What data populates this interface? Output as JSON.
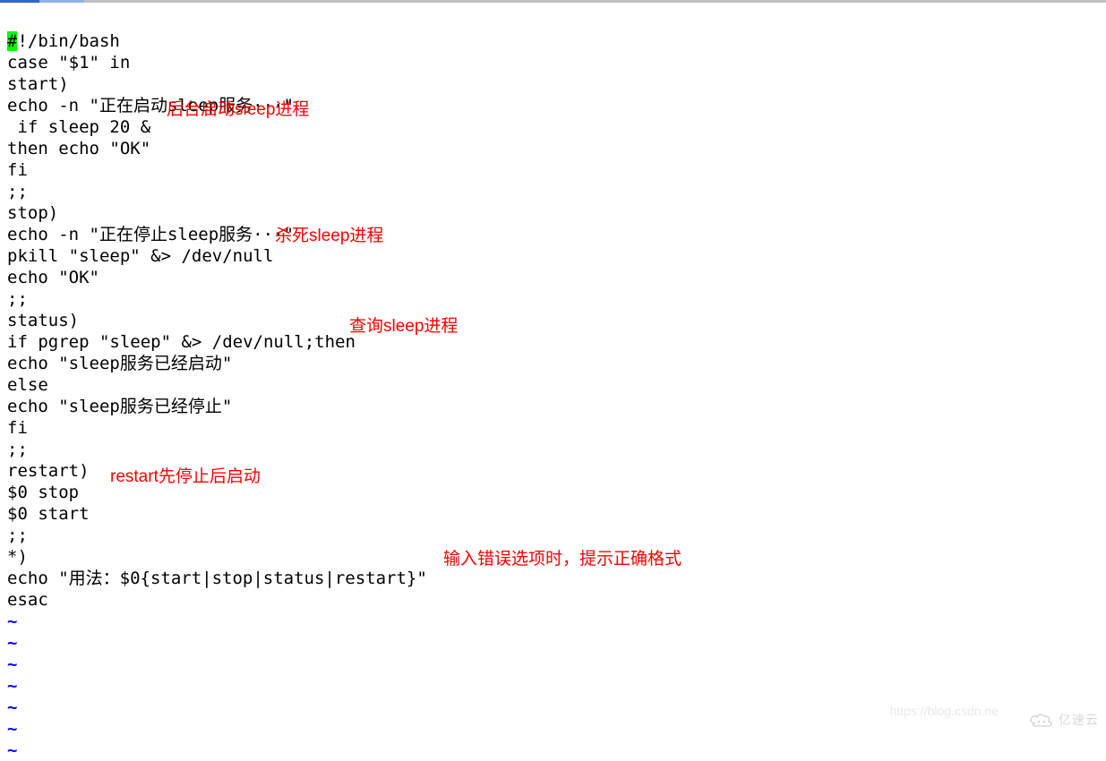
{
  "code": {
    "first_char": "#",
    "line1_rest": "!/bin/bash",
    "line2": "case \"$1\" in",
    "line3": "start)",
    "line4": "echo -n \"正在启动sleep服务···\"",
    "line5": " if sleep 20 &",
    "line6": "then echo \"OK\"",
    "line7": "fi",
    "line8": ";;",
    "line9": "stop)",
    "line10": "echo -n \"正在停止sleep服务···\"",
    "line11": "pkill \"sleep\" &> /dev/null",
    "line12": "echo \"OK\"",
    "line13": ";;",
    "line14": "status)",
    "line15": "if pgrep \"sleep\" &> /dev/null;then",
    "line16": "echo \"sleep服务已经启动\"",
    "line17": "else",
    "line18": "echo \"sleep服务已经停止\"",
    "line19": "fi",
    "line20": ";;",
    "line21": "restart)",
    "line22": "$0 stop",
    "line23": "$0 start",
    "line24": ";;",
    "line25": "*)",
    "line26": "echo \"用法：$0{start|stop|status|restart}\"",
    "line27": "esac",
    "tilde": "~"
  },
  "annotations": {
    "a1": "后台启动sleep进程",
    "a2": "杀死sleep进程",
    "a3": "查询sleep进程",
    "a4": "restart先停止后启动",
    "a5": "输入错误选项时，提示正确格式"
  },
  "watermark": {
    "url": "https://blog.csdn.ne",
    "brand": "亿速云"
  }
}
